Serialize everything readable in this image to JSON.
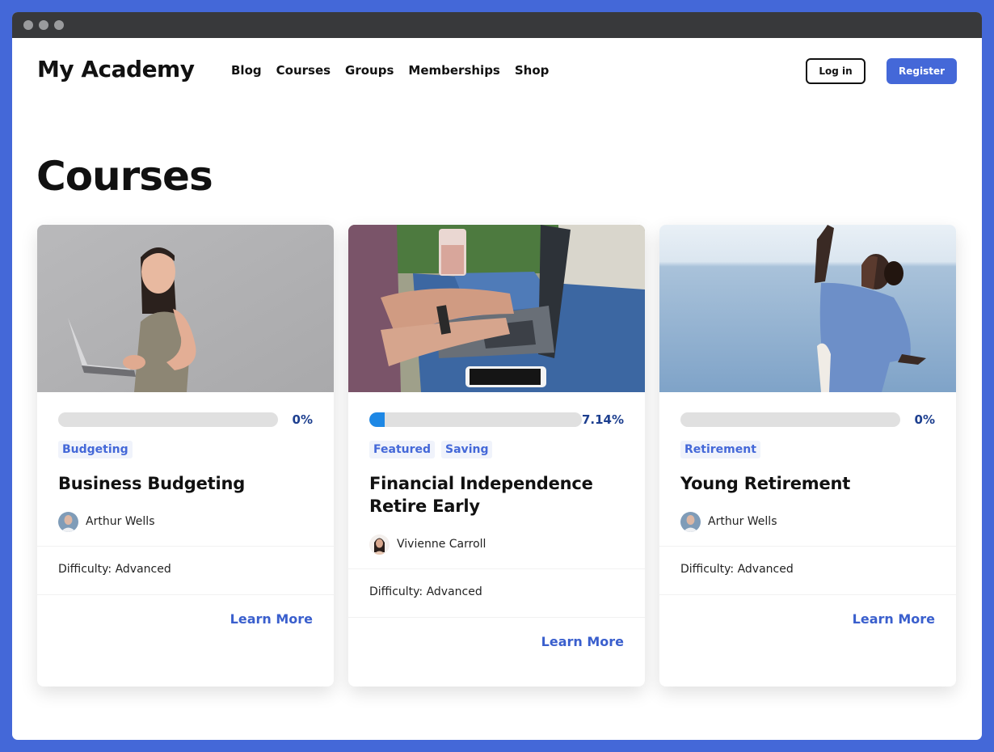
{
  "window": {
    "controls": [
      "close",
      "minimize",
      "maximize"
    ]
  },
  "header": {
    "logo": "My Academy",
    "nav": [
      "Blog",
      "Courses",
      "Groups",
      "Memberships",
      "Shop"
    ],
    "login_label": "Log in",
    "register_label": "Register"
  },
  "colors": {
    "accent": "#4468d8",
    "progress_fill": "#1e88e5",
    "progress_track": "#e0e0e0",
    "percent_text": "#1d3f8f"
  },
  "page": {
    "title": "Courses"
  },
  "courses": [
    {
      "image": "woman-holding-laptop-photo",
      "progress_percent": 0,
      "progress_label": "0%",
      "tags": [
        "Budgeting"
      ],
      "title": "Business Budgeting",
      "author": "Arthur Wells",
      "author_avatar": "male-avatar",
      "difficulty": "Difficulty: Advanced",
      "cta": "Learn More"
    },
    {
      "image": "person-typing-on-laptop-photo",
      "progress_percent": 7.14,
      "progress_label": "7.14%",
      "tags": [
        "Featured",
        "Saving"
      ],
      "title": "Financial Independence Retire Early",
      "author": "Vivienne Carroll",
      "author_avatar": "female-avatar",
      "difficulty": "Difficulty: Advanced",
      "cta": "Learn More"
    },
    {
      "image": "woman-by-sea-photo",
      "progress_percent": 0,
      "progress_label": "0%",
      "tags": [
        "Retirement"
      ],
      "title": "Young Retirement",
      "author": "Arthur Wells",
      "author_avatar": "male-avatar",
      "difficulty": "Difficulty: Advanced",
      "cta": "Learn More"
    }
  ]
}
